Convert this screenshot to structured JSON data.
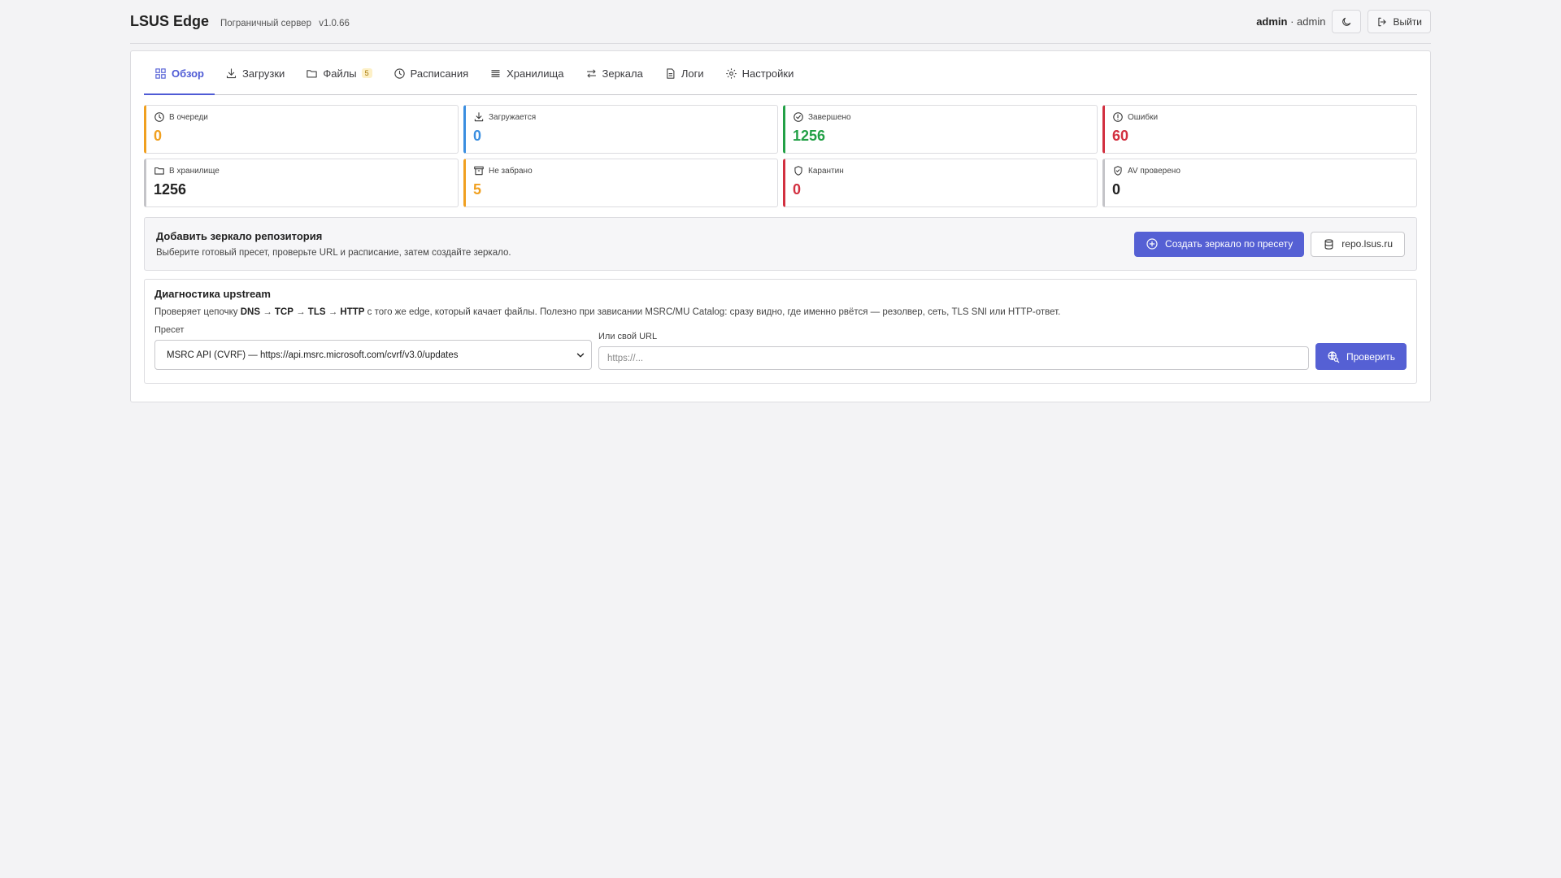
{
  "header": {
    "title": "LSUS Edge",
    "subtitle": "Пограничный сервер",
    "version": "v1.0.66",
    "user_name": "admin",
    "user_sep": " · ",
    "user_role": "admin",
    "logout_label": "Выйти"
  },
  "tabs": [
    {
      "label": "Обзор",
      "icon": "dashboard-icon",
      "active": true
    },
    {
      "label": "Загрузки",
      "icon": "download-icon"
    },
    {
      "label": "Файлы",
      "icon": "folder-icon",
      "badge": "5"
    },
    {
      "label": "Расписания",
      "icon": "clock-icon"
    },
    {
      "label": "Хранилища",
      "icon": "storage-icon"
    },
    {
      "label": "Зеркала",
      "icon": "swap-arrows-icon"
    },
    {
      "label": "Логи",
      "icon": "document-icon"
    },
    {
      "label": "Настройки",
      "icon": "gear-icon"
    }
  ],
  "stats": [
    {
      "label": "В очереди",
      "value": "0",
      "color": "#f0a020",
      "icon": "clock-icon"
    },
    {
      "label": "Загружается",
      "value": "0",
      "color": "#3a8ee0",
      "icon": "download-icon"
    },
    {
      "label": "Завершено",
      "value": "1256",
      "color": "#22a046",
      "icon": "check-circle-icon"
    },
    {
      "label": "Ошибки",
      "value": "60",
      "color": "#d23040",
      "icon": "alert-circle-icon"
    },
    {
      "label": "В хранилище",
      "value": "1256",
      "color": "#222222",
      "icon": "folder-icon"
    },
    {
      "label": "Не забрано",
      "value": "5",
      "color": "#f0a020",
      "icon": "archive-icon"
    },
    {
      "label": "Карантин",
      "value": "0",
      "color": "#d23040",
      "icon": "shield-icon"
    },
    {
      "label": "AV проверено",
      "value": "0",
      "color": "#222222",
      "icon": "shield-check-icon"
    }
  ],
  "mirror": {
    "title": "Добавить зеркало репозитория",
    "description": "Выберите готовый пресет, проверьте URL и расписание, затем создайте зеркало.",
    "create_label": "Создать зеркало по пресету",
    "repo_label": "repo.lsus.ru"
  },
  "diagnostics": {
    "title": "Диагностика upstream",
    "desc_prefix": "Проверяет цепочку ",
    "chain": [
      "DNS",
      "TCP",
      "TLS",
      "HTTP"
    ],
    "arrow": " → ",
    "desc_suffix": " с того же edge, который качает файлы. Полезно при зависании MSRC/MU Catalog: сразу видно, где именно рвётся — резолвер, сеть, TLS SNI или HTTP-ответ.",
    "preset_label": "Пресет",
    "preset_value": "MSRC API (CVRF) — https://api.msrc.microsoft.com/cvrf/v3.0/updates",
    "url_label": "Или свой URL",
    "url_placeholder": "https://...",
    "check_label": "Проверить"
  }
}
